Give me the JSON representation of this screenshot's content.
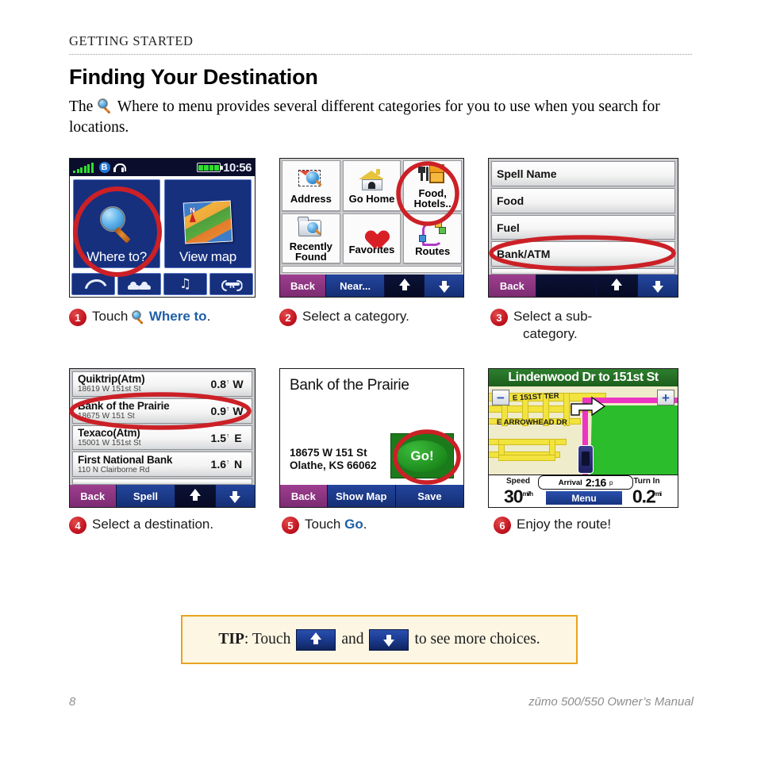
{
  "header": {
    "running_head": "Getting Started",
    "title": "Finding Your Destination",
    "intro_before": "The",
    "intro_after": "Where to menu provides several different categories for you to use when you search for locations."
  },
  "screens": {
    "home": {
      "status": {
        "time": "10:56",
        "signal_icon": "signal-bars-icon",
        "bluetooth_icon": "bluetooth-icon",
        "headset_icon": "headset-icon",
        "battery_icon": "battery-icon"
      },
      "buttons": [
        {
          "label": "Where to?",
          "icon": "magnifier-icon"
        },
        {
          "label": "View map",
          "icon": "map-thumbnail-icon"
        }
      ],
      "toolbar": [
        {
          "icon": "phone-icon"
        },
        {
          "icon": "traffic-cars-icon"
        },
        {
          "icon": "music-note-icon"
        },
        {
          "icon": "wrench-tools-icon"
        }
      ]
    },
    "categories": {
      "items": [
        {
          "label": "Address",
          "icon": "envelope-magnifier-icon"
        },
        {
          "label": "Go Home",
          "icon": "house-icon"
        },
        {
          "label": "Food,\nHotels..",
          "icon": "food-hotel-icon"
        },
        {
          "label": "Recently\nFound",
          "icon": "folder-magnifier-icon"
        },
        {
          "label": "Favorites",
          "icon": "heart-icon"
        },
        {
          "label": "Routes",
          "icon": "routes-icon"
        }
      ],
      "footer": [
        {
          "label": "Back",
          "style": "purple"
        },
        {
          "label": "Near...",
          "style": "blue"
        },
        {
          "label": "",
          "style": "dark",
          "icon": "arrow-up-icon"
        },
        {
          "label": "",
          "style": "blue",
          "icon": "arrow-down-icon"
        }
      ]
    },
    "subcategories": {
      "items": [
        "Spell Name",
        "Food",
        "Fuel",
        "Bank/ATM"
      ],
      "selected": "Bank/ATM",
      "footer": [
        {
          "label": "Back",
          "style": "purple"
        },
        {
          "label": "",
          "style": "dark"
        },
        {
          "label": "",
          "style": "dark",
          "icon": "arrow-up-icon"
        },
        {
          "label": "",
          "style": "blue",
          "icon": "arrow-down-icon"
        }
      ]
    },
    "results": {
      "rows": [
        {
          "name": "Quiktrip(Atm)",
          "address": "18619 W 151st St",
          "distance": "0.8",
          "unit": "mi",
          "direction": "W"
        },
        {
          "name": "Bank of the Prairie",
          "address": "18675 W 151 St",
          "distance": "0.9",
          "unit": "mi",
          "direction": "W"
        },
        {
          "name": "Texaco(Atm)",
          "address": "15001 W 151st St",
          "distance": "1.5",
          "unit": "mi",
          "direction": "E"
        },
        {
          "name": "First National Bank",
          "address": "110 N Clairborne Rd",
          "distance": "1.6",
          "unit": "mi",
          "direction": "N"
        }
      ],
      "selected": "Bank of the Prairie",
      "footer": [
        {
          "label": "Back",
          "style": "purple"
        },
        {
          "label": "Spell",
          "style": "blue"
        },
        {
          "label": "",
          "style": "dark",
          "icon": "arrow-up-icon"
        },
        {
          "label": "",
          "style": "blue",
          "icon": "arrow-down-icon"
        }
      ]
    },
    "detail": {
      "title": "Bank of the Prairie",
      "address_line1": "18675 W 151 St",
      "address_line2": "Olathe, KS 66062",
      "go_label": "Go!",
      "footer": [
        {
          "label": "Back",
          "style": "purple"
        },
        {
          "label": "Show Map",
          "style": "blue"
        },
        {
          "label": "Save",
          "style": "blue"
        }
      ]
    },
    "navmap": {
      "banner": "Lindenwood Dr to 151st St",
      "street_labels": [
        "E 151ST TER",
        "E ARROWHEAD DR"
      ],
      "zoom_out": "−",
      "zoom_in": "+",
      "speed_caption": "Speed",
      "speed_value": "30",
      "speed_unit": "mi/h",
      "arrival_caption": "Arrival",
      "arrival_value": "2:16",
      "arrival_unit": "p",
      "menu_label": "Menu",
      "turnin_caption": "Turn In",
      "turnin_value": "0.2",
      "turnin_unit": "mi"
    }
  },
  "steps": [
    {
      "num": "1",
      "text_before": "Touch ",
      "icon": "magnifier-icon",
      "link": "Where to",
      "text_after": "."
    },
    {
      "num": "2",
      "text_before": "Select a category.",
      "link": "",
      "text_after": ""
    },
    {
      "num": "3",
      "text_before": "Select a sub-",
      "line2": "category.",
      "link": "",
      "text_after": ""
    },
    {
      "num": "4",
      "text_before": "Select a destination.",
      "link": "",
      "text_after": ""
    },
    {
      "num": "5",
      "text_before": "Touch ",
      "link": "Go",
      "text_after": "."
    },
    {
      "num": "6",
      "text_before": "Enjoy the route!",
      "link": "",
      "text_after": ""
    }
  ],
  "tip": {
    "label": "TIP",
    "text1": ": Touch",
    "text2": "and",
    "text3": "to see more choices.",
    "up_icon": "arrow-up-icon",
    "down_icon": "arrow-down-icon"
  },
  "footer": {
    "page_number": "8",
    "manual_title": "zūmo 500/550 Owner’s Manual"
  },
  "colors": {
    "accent_blue": "#1f5fa9",
    "bullet_red": "#c1121f",
    "tip_border": "#e8a41f",
    "tip_bg": "#fdf6e3",
    "device_blue": "#16307e"
  }
}
